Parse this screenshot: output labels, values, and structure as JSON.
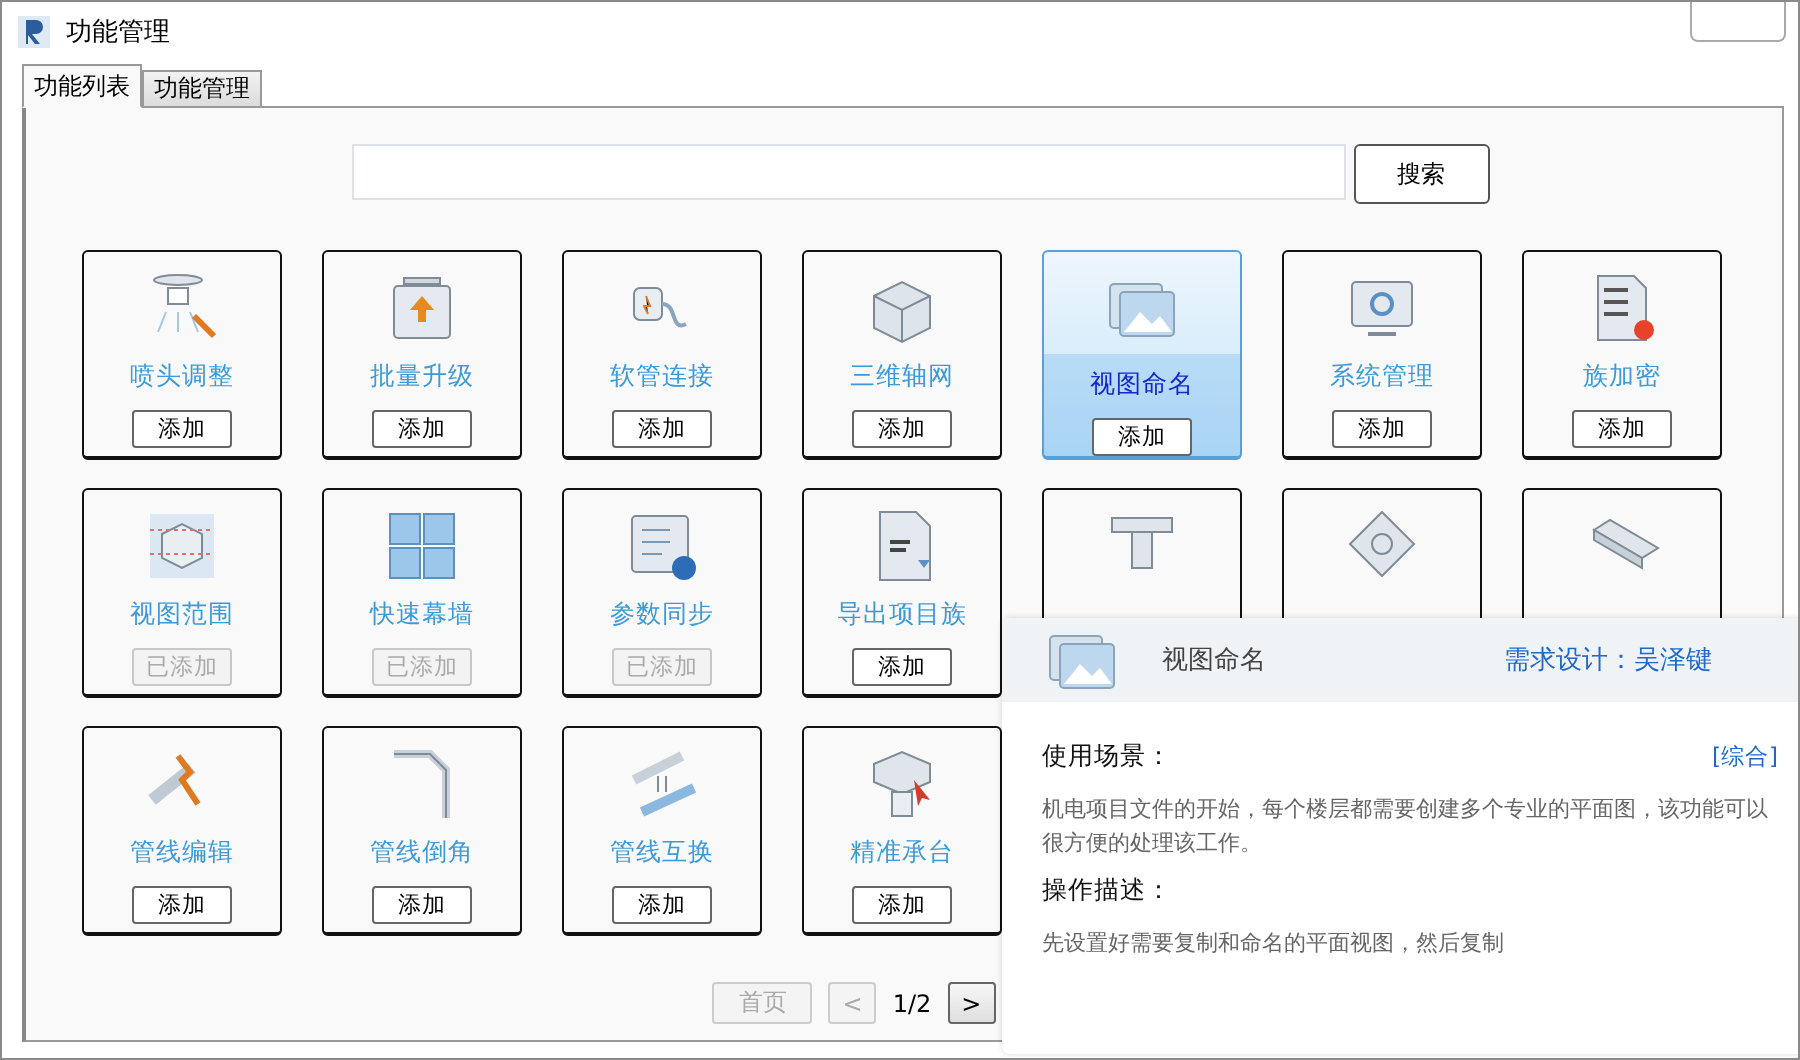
{
  "window": {
    "title": "功能管理"
  },
  "tabs": [
    {
      "label": "功能列表",
      "selected": true
    },
    {
      "label": "功能管理",
      "selected": false
    }
  ],
  "search": {
    "button": "搜索"
  },
  "cards": [
    {
      "label": "喷头调整",
      "selected": false,
      "button": {
        "label": "添加",
        "disabled": false
      }
    },
    {
      "label": "批量升级",
      "selected": false,
      "button": {
        "label": "添加",
        "disabled": false
      }
    },
    {
      "label": "软管连接",
      "selected": false,
      "button": {
        "label": "添加",
        "disabled": false
      }
    },
    {
      "label": "三维轴网",
      "selected": false,
      "button": {
        "label": "添加",
        "disabled": false
      }
    },
    {
      "label": "视图命名",
      "selected": true,
      "button": {
        "label": "添加",
        "disabled": false
      }
    },
    {
      "label": "系统管理",
      "selected": false,
      "button": {
        "label": "添加",
        "disabled": false
      }
    },
    {
      "label": "族加密",
      "selected": false,
      "button": {
        "label": "添加",
        "disabled": false
      }
    },
    {
      "label": "视图范围",
      "selected": false,
      "button": {
        "label": "已添加",
        "disabled": true
      }
    },
    {
      "label": "快速幕墙",
      "selected": false,
      "button": {
        "label": "已添加",
        "disabled": true
      }
    },
    {
      "label": "参数同步",
      "selected": false,
      "button": {
        "label": "已添加",
        "disabled": true
      }
    },
    {
      "label": "导出项目族",
      "selected": false,
      "button": {
        "label": "添加",
        "disabled": false
      }
    },
    {
      "selected": false
    },
    {
      "selected": false
    },
    {
      "selected": false
    },
    {
      "label": "管线编辑",
      "selected": false,
      "button": {
        "label": "添加",
        "disabled": false
      }
    },
    {
      "label": "管线倒角",
      "selected": false,
      "button": {
        "label": "添加",
        "disabled": false
      }
    },
    {
      "label": "管线互换",
      "selected": false,
      "button": {
        "label": "添加",
        "disabled": false
      }
    },
    {
      "label": "精准承台",
      "selected": false,
      "button": {
        "label": "添加",
        "disabled": false
      }
    }
  ],
  "pagination": {
    "first": {
      "label": "首页",
      "disabled": true
    },
    "prev": {
      "label": "<",
      "disabled": true
    },
    "page": "1/2",
    "next": {
      "label": ">",
      "disabled": false
    }
  },
  "popup": {
    "title": "视图命名",
    "designer": "需求设计：吴泽键",
    "sections": [
      {
        "heading": "使用场景：",
        "tag": "[综合]",
        "text": "机电项目文件的开始，每个楼层都需要创建多个专业的平面图，该功能可以很方便的处理该工作。"
      },
      {
        "heading": "操作描述：",
        "text": "先设置好需要复制和命名的平面视图，然后复制"
      }
    ]
  }
}
